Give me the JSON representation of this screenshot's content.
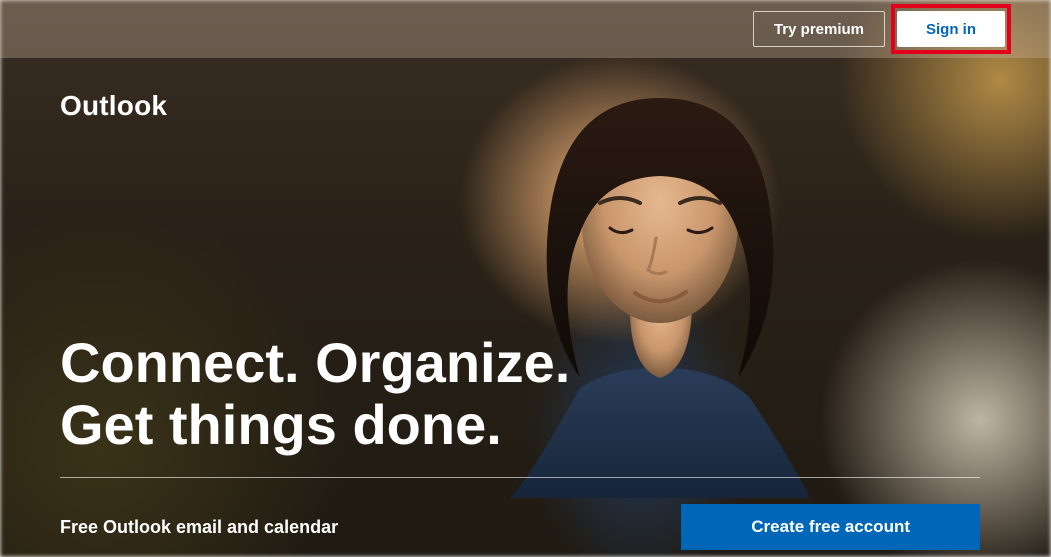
{
  "header": {
    "try_premium_label": "Try premium",
    "sign_in_label": "Sign in"
  },
  "hero": {
    "brand": "Outlook",
    "headline_line1": "Connect. Organize.",
    "headline_line2": "Get things done.",
    "subtext": "Free Outlook email and calendar",
    "create_account_label": "Create free account"
  },
  "colors": {
    "accent": "#0067b8",
    "highlight": "#e3001b"
  }
}
